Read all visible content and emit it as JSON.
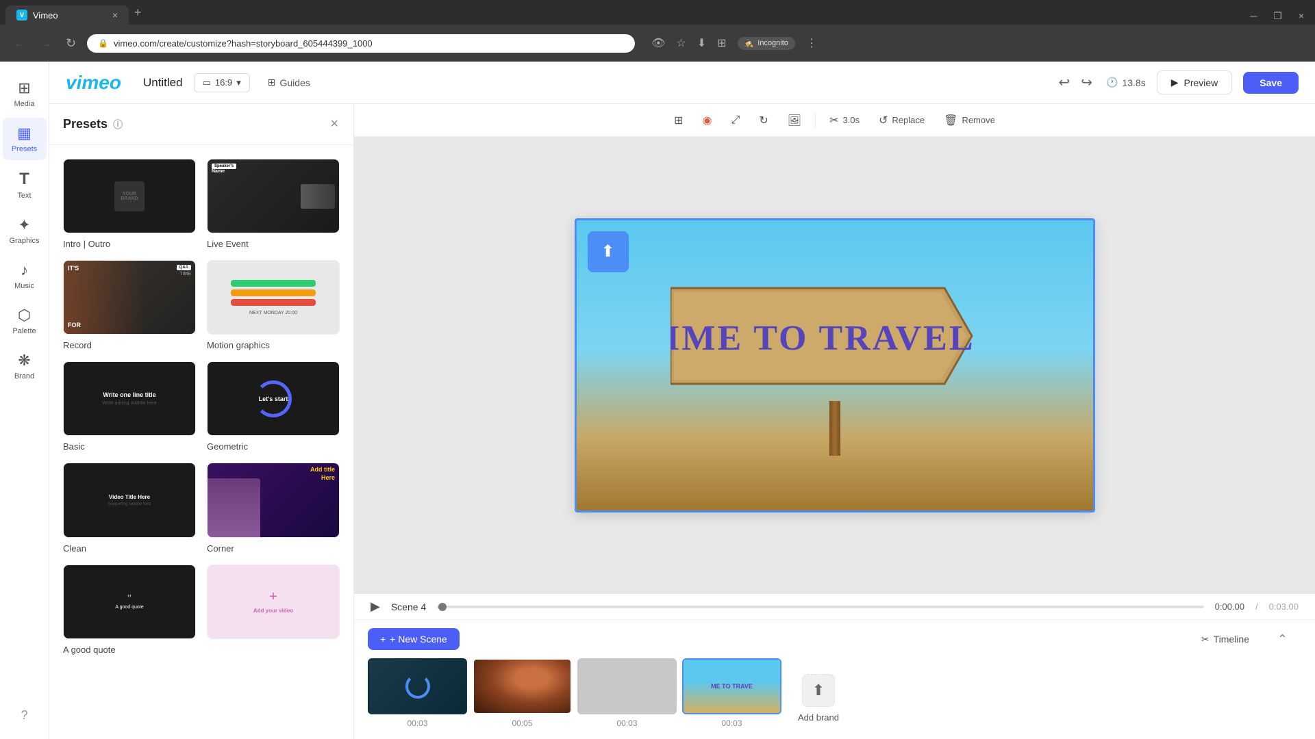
{
  "browser": {
    "tab_title": "Vimeo",
    "url": "vimeo.com/create/customize?hash=storyboard_605444399_1000",
    "new_tab_icon": "+",
    "close_icon": "×",
    "win_minimize": "─",
    "win_maximize": "❐",
    "win_close": "×"
  },
  "topbar": {
    "logo": "vimeo",
    "project_title": "Untitled",
    "aspect_ratio": "16:9",
    "guides_label": "Guides",
    "undo_icon": "↩",
    "redo_icon": "↪",
    "timer": "13.8s",
    "preview_label": "Preview",
    "save_label": "Save"
  },
  "sidebar": {
    "items": [
      {
        "id": "media",
        "label": "Media",
        "icon": "⊞"
      },
      {
        "id": "presets",
        "label": "Presets",
        "icon": "⊟",
        "active": true
      },
      {
        "id": "text",
        "label": "Text",
        "icon": "T"
      },
      {
        "id": "graphics",
        "label": "Graphics",
        "icon": "✦"
      },
      {
        "id": "music",
        "label": "Music",
        "icon": "♪"
      },
      {
        "id": "palette",
        "label": "Palette",
        "icon": "⬡"
      },
      {
        "id": "brand",
        "label": "Brand",
        "icon": "❋"
      }
    ],
    "help_icon": "?"
  },
  "presets_panel": {
    "title": "Presets",
    "items": [
      {
        "id": "intro-outro",
        "label": "Intro | Outro"
      },
      {
        "id": "live-event",
        "label": "Live Event"
      },
      {
        "id": "record",
        "label": "Record"
      },
      {
        "id": "motion-graphics",
        "label": "Motion graphics"
      },
      {
        "id": "basic",
        "label": "Basic"
      },
      {
        "id": "geometric",
        "label": "Geometric"
      },
      {
        "id": "clean",
        "label": "Clean"
      },
      {
        "id": "corner",
        "label": "Corner"
      },
      {
        "id": "quote",
        "label": "A good quote"
      },
      {
        "id": "add-video",
        "label": "Add your video"
      }
    ]
  },
  "editor": {
    "toolbar_tools": [
      {
        "id": "grid",
        "icon": "⊞",
        "label": ""
      },
      {
        "id": "color",
        "icon": "◉",
        "label": ""
      },
      {
        "id": "expand",
        "icon": "⤢",
        "label": ""
      },
      {
        "id": "rotate",
        "icon": "↻",
        "label": ""
      },
      {
        "id": "image",
        "icon": "🖼",
        "label": ""
      },
      {
        "id": "trim",
        "icon": "✂",
        "label": "3.0s"
      },
      {
        "id": "replace",
        "icon": "↺",
        "label": "Replace"
      },
      {
        "id": "remove",
        "icon": "🗑",
        "label": "Remove"
      }
    ],
    "canvas_title": "TIME TO TRAVEL"
  },
  "timeline": {
    "play_icon": "▶",
    "scene_label": "Scene 4",
    "time_current": "0:00.00",
    "time_total": "0:03.00",
    "new_scene_label": "+ New Scene",
    "timeline_label": "Timeline",
    "collapse_icon": "⌃",
    "scenes": [
      {
        "id": 1,
        "duration": "00:03",
        "active": false,
        "type": "loading"
      },
      {
        "id": 2,
        "duration": "00:05",
        "active": false,
        "type": "hearts"
      },
      {
        "id": 3,
        "duration": "00:03",
        "active": false,
        "type": "blank"
      },
      {
        "id": 4,
        "duration": "00:03",
        "active": true,
        "type": "travel"
      }
    ],
    "add_brand_label": "Add brand"
  },
  "corner_preset": {
    "text": "Add title Here"
  }
}
